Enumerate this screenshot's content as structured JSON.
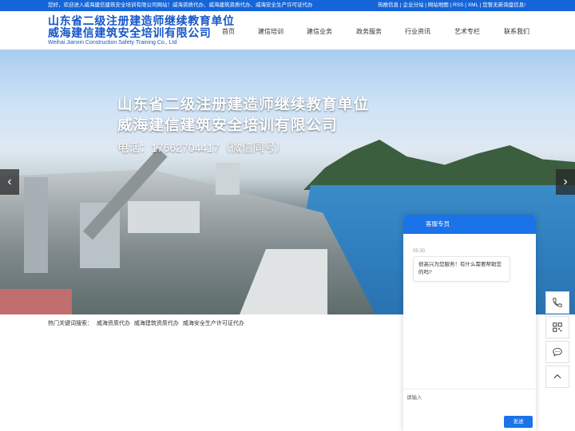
{
  "topbar": {
    "welcome": "您好，欢迎进入威海建信建筑安全培训有限公司网站！威海资质代办、威海建筑资质代办、威海安全生产许可证代办",
    "links": [
      "热推信息",
      "企业分站",
      "网站地图",
      "RSS",
      "XML",
      "您暂无新询盘信息!"
    ]
  },
  "logo": {
    "line1": "山东省二级注册建造师继续教育单位",
    "line2": "威海建信建筑安全培训有限公司",
    "line3": "Weihai Jianxin Construction Safety Training Co., Ltd"
  },
  "nav": {
    "items": [
      {
        "label": "首页"
      },
      {
        "label": "建信培训"
      },
      {
        "label": "建信业务"
      },
      {
        "label": "政务服务"
      },
      {
        "label": "行业资讯"
      },
      {
        "label": "艺术专栏"
      },
      {
        "label": "联系我们"
      }
    ]
  },
  "banner": {
    "headline1": "山东省二级注册建造师继续教育单位",
    "headline2": "威海建信建筑安全培训有限公司",
    "phone": "电话：17662704417（微信同号）",
    "prev": "‹",
    "next": "›"
  },
  "keywords": {
    "label": "热门关键词搜索：",
    "items": [
      "威海资质代办",
      "威海建筑资质代办",
      "威海安全生产许可证代办"
    ]
  },
  "chat": {
    "title": "客服专员",
    "time": "05:30",
    "message": "很高兴为您服务！有什么需要帮助您的吗?",
    "input_placeholder": "请输入",
    "send": "发送"
  },
  "side_tools": [
    "phone-icon",
    "qrcode-icon",
    "message-icon",
    "back-to-top-icon"
  ],
  "colors": {
    "brand": "#1565d8",
    "accent": "#1a73e8"
  }
}
